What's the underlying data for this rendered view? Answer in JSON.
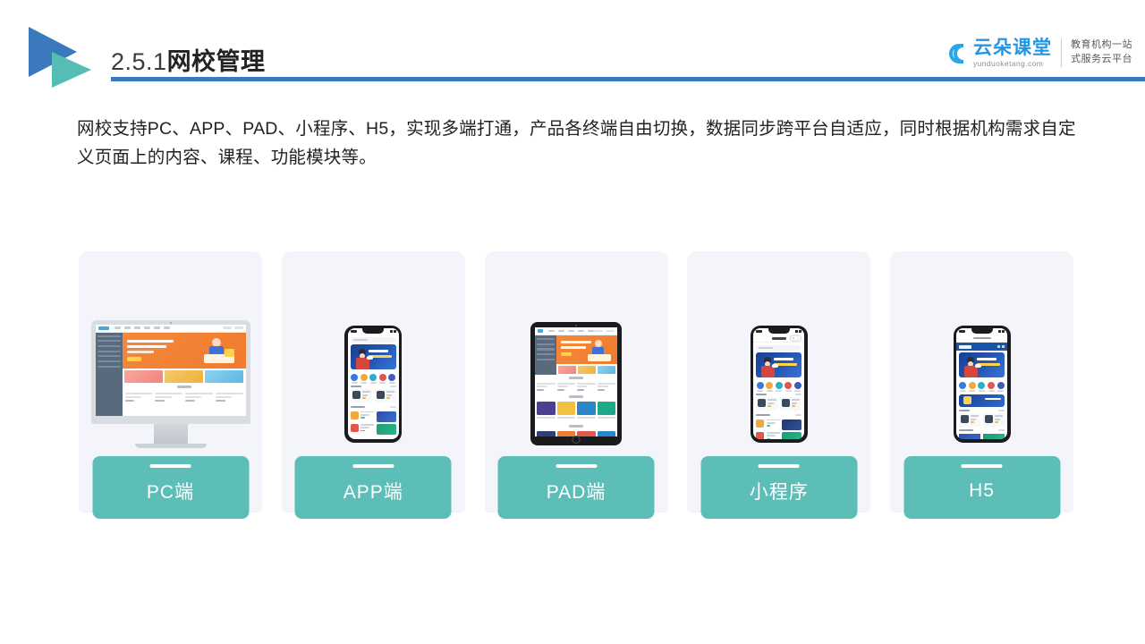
{
  "header": {
    "title_number": "2.5.1",
    "title_name": "网校管理",
    "rule_color": "#3b79bd",
    "logo_blue": "#3b79bd",
    "logo_teal": "#56bdb4"
  },
  "brand": {
    "name": "云朵课堂",
    "domain": "yunduoketang.com",
    "tagline_line1": "教育机构一站",
    "tagline_line2": "式服务云平台",
    "name_color": "#2196e3"
  },
  "intro": {
    "paragraph": "网校支持PC、APP、PAD、小程序、H5，实现多端打通，产品各终端自由切换，数据同步跨平台自适应，同时根据机构需求自定义页面上的内容、课程、功能模块等。"
  },
  "cards": {
    "chip_color": "#5cbeb7",
    "card_bg": "#f3f5fb",
    "items": [
      {
        "label": "PC端",
        "device": "desktop-monitor"
      },
      {
        "label": "APP端",
        "device": "smartphone"
      },
      {
        "label": "PAD端",
        "device": "tablet"
      },
      {
        "label": "小程序",
        "device": "smartphone-miniprogram"
      },
      {
        "label": "H5",
        "device": "smartphone-browser"
      }
    ]
  }
}
